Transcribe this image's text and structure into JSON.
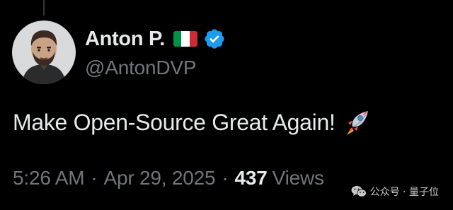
{
  "author": {
    "display_name": "Anton P.",
    "flag": "italy-flag-icon",
    "verified": true,
    "handle": "@AntonDVP",
    "avatar": "avatar-cartoon-bearded-man"
  },
  "tweet": {
    "text": "Make Open-Source Great Again!",
    "emoji": "rocket-icon"
  },
  "meta": {
    "time": "5:26 AM",
    "separator": "·",
    "date": "Apr 29, 2025",
    "views_count": "437",
    "views_label": "Views"
  },
  "watermark": {
    "text": "公众号 · 量子位",
    "icon": "wechat-icon"
  },
  "colors": {
    "background": "#000000",
    "primary_text": "#e7e9ea",
    "secondary_text": "#71767b",
    "verified_blue": "#1d9bf0",
    "flag_green": "#009246",
    "flag_white": "#ffffff",
    "flag_red": "#ce2b37"
  }
}
